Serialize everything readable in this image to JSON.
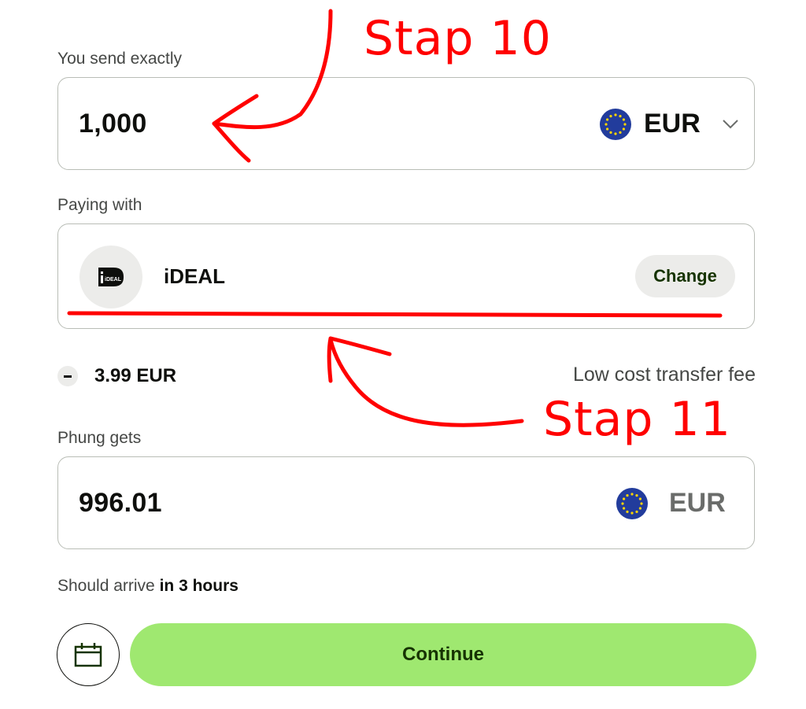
{
  "send": {
    "label": "You send exactly",
    "amount": "1,000",
    "currency": "EUR"
  },
  "paying": {
    "label": "Paying with",
    "method": "iDEAL",
    "logo_text": "iDEAL",
    "change_label": "Change"
  },
  "fee": {
    "amount": "3.99 EUR",
    "description": "Low cost transfer fee"
  },
  "receive": {
    "label": "Phung gets",
    "amount": "996.01",
    "currency": "EUR"
  },
  "arrival": {
    "prefix": "Should arrive",
    "time": "in 3 hours"
  },
  "actions": {
    "continue_label": "Continue"
  },
  "annotations": {
    "step_a": "Stap 10",
    "step_b": "Stap 11"
  },
  "colors": {
    "accent": "#9fe870",
    "annotation": "#ff0000",
    "flag_blue": "#223c9c",
    "flag_star": "#ffd500"
  },
  "icons": [
    "eu-flag-icon",
    "chevron-down-icon",
    "ideal-logo-icon",
    "minus-icon",
    "calendar-icon"
  ]
}
